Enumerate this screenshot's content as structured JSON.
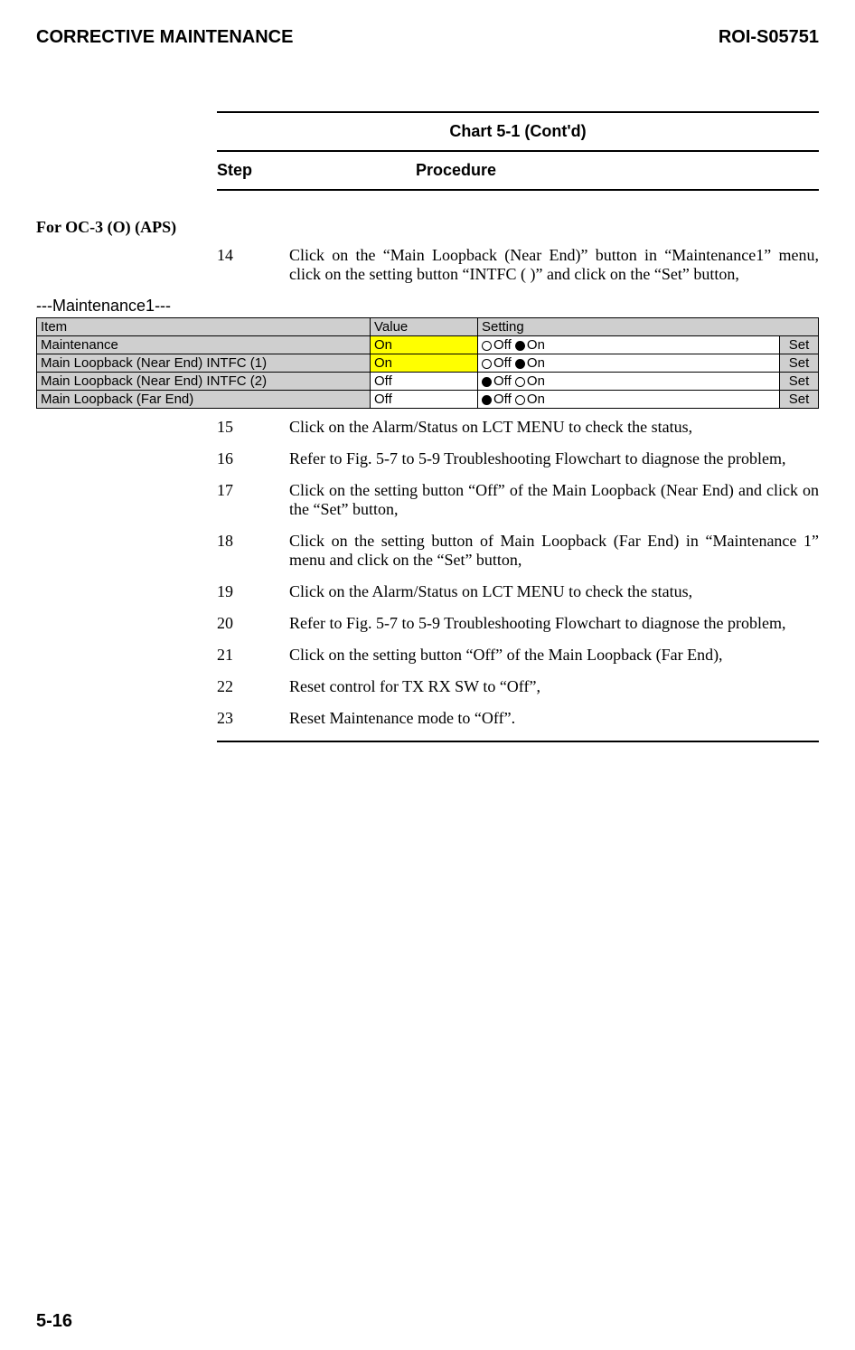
{
  "header": {
    "left": "CORRECTIVE MAINTENANCE",
    "right": "ROI-S05751"
  },
  "chart": {
    "title": "Chart 5-1  (Cont'd)",
    "col_step": "Step",
    "col_proc": "Procedure"
  },
  "section": "For OC-3 (O) (APS)",
  "steps_a": [
    {
      "n": "14",
      "t": "Click on the “Main Loopback (Near End)” button in “Maintenance1” menu, click on the setting button “INTFC ( )” and click on the “Set” button,"
    }
  ],
  "maint_label": "---Maintenance1---",
  "table": {
    "headers": {
      "item": "Item",
      "value": "Value",
      "setting": "Setting"
    },
    "off": "Off",
    "on": "On",
    "set": "Set",
    "rows": [
      {
        "item": "Maintenance",
        "value": "On",
        "value_hl": true,
        "sel": "on"
      },
      {
        "item": "Main Loopback (Near End) INTFC (1)",
        "value": "On",
        "value_hl": true,
        "sel": "on"
      },
      {
        "item": "Main Loopback (Near End) INTFC (2)",
        "value": "Off",
        "value_hl": false,
        "sel": "off"
      },
      {
        "item": "Main Loopback (Far End)",
        "value": "Off",
        "value_hl": false,
        "sel": "off"
      }
    ]
  },
  "steps_b": [
    {
      "n": "15",
      "t": "Click on the Alarm/Status on LCT MENU to check the status,"
    },
    {
      "n": "16",
      "t": "Refer to Fig. 5-7 to 5-9 Troubleshooting Flowchart to diagnose the problem,"
    },
    {
      "n": "17",
      "t": "Click on the setting button “Off” of the Main Loopback (Near End) and click on the “Set” button,"
    },
    {
      "n": "18",
      "t": "Click on the setting button of Main Loopback (Far End) in “Maintenance 1” menu and click on the “Set” button,"
    },
    {
      "n": "19",
      "t": "Click on the Alarm/Status on LCT MENU to check the status,"
    },
    {
      "n": "20",
      "t": "Refer to Fig. 5-7 to 5-9 Troubleshooting Flowchart to diagnose the problem,"
    },
    {
      "n": "21",
      "t": "Click on the setting button “Off” of the Main Loopback (Far End),"
    },
    {
      "n": "22",
      "t": "Reset control for TX RX SW to “Off”,"
    },
    {
      "n": "23",
      "t": "Reset Maintenance mode to “Off”."
    }
  ],
  "footer": "5-16"
}
